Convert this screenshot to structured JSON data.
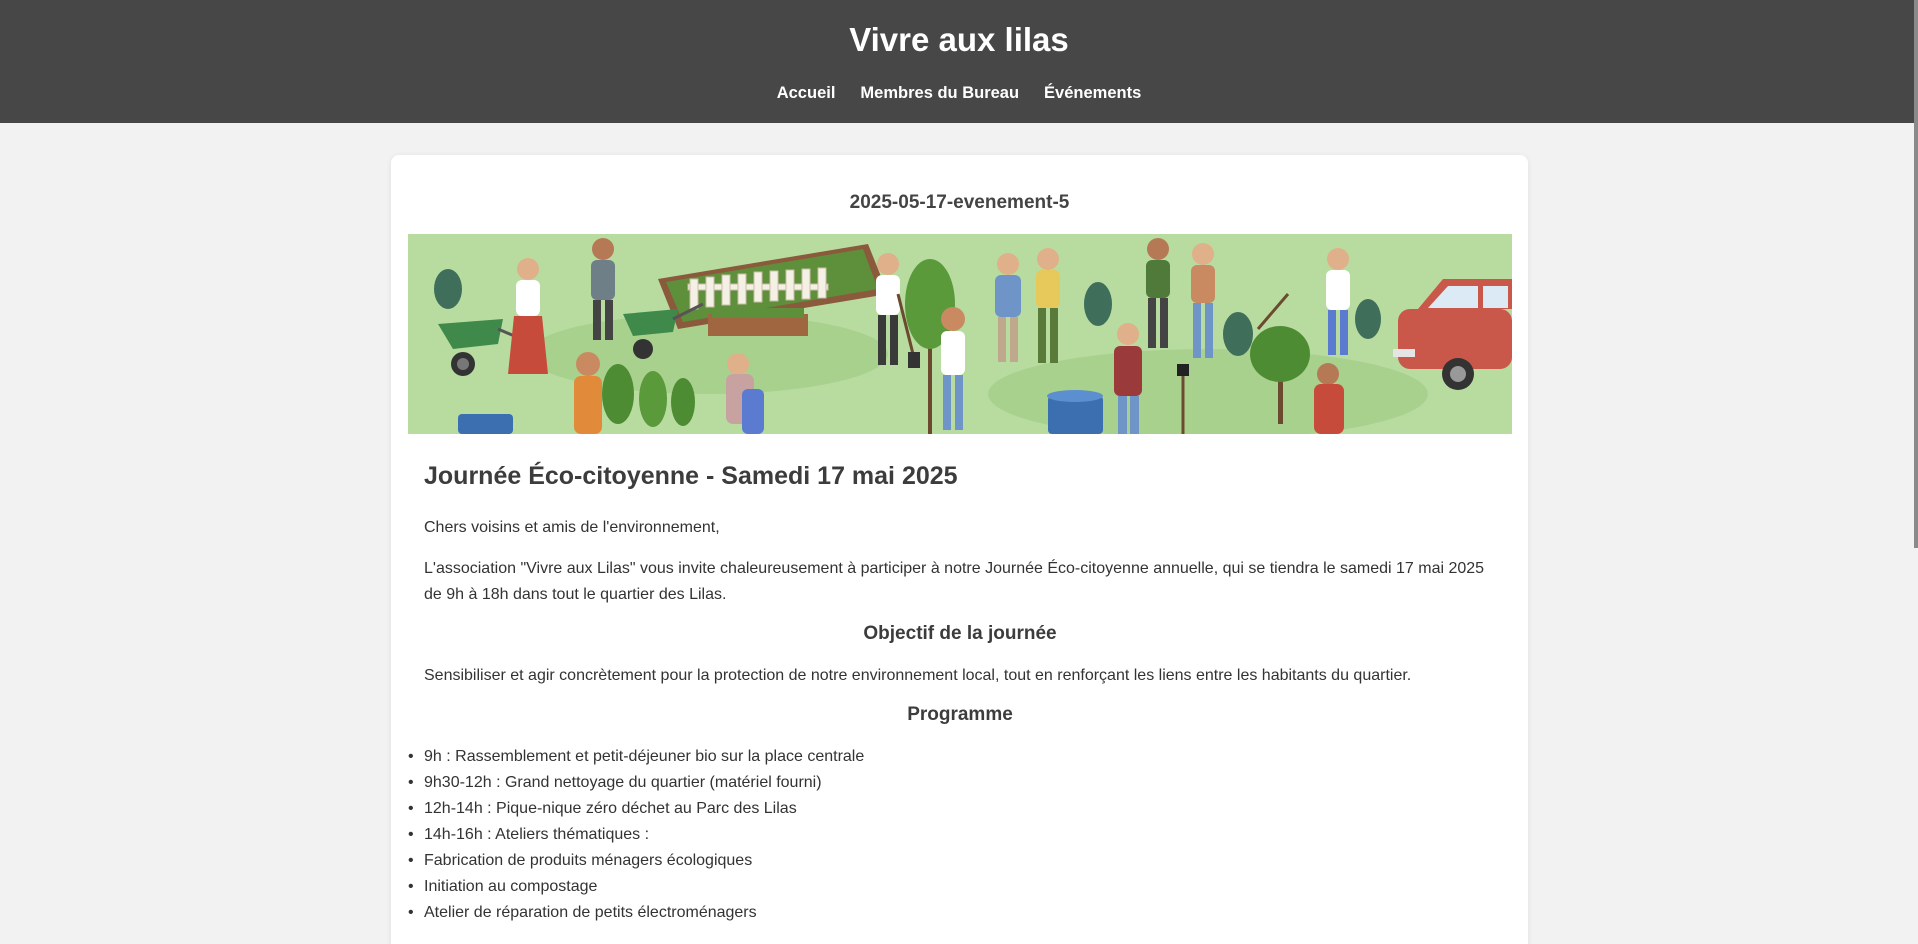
{
  "site": {
    "title": "Vivre aux lilas"
  },
  "nav": [
    {
      "label": "Accueil"
    },
    {
      "label": "Membres du Bureau"
    },
    {
      "label": "Événements"
    }
  ],
  "event": {
    "id": "2025-05-17-evenement-5",
    "title": "Journée Éco-citoyenne - Samedi 17 mai 2025",
    "greeting": "Chers voisins et amis de l'environnement,",
    "intro": "L'association \"Vivre aux Lilas\" vous invite chaleureusement à participer à notre Journée Éco-citoyenne annuelle, qui se tiendra le samedi 17 mai 2025 de 9h à 18h dans tout le quartier des Lilas.",
    "objective_heading": "Objectif de la journée",
    "objective_text": "Sensibiliser et agir concrètement pour la protection de notre environnement local, tout en renforçant les liens entre les habitants du quartier.",
    "program_heading": "Programme",
    "program": [
      "9h : Rassemblement et petit-déjeuner bio sur la place centrale",
      "9h30-12h : Grand nettoyage du quartier (matériel fourni)",
      "12h-14h : Pique-nique zéro déchet au Parc des Lilas",
      "14h-16h : Ateliers thématiques :",
      "Fabrication de produits ménagers écologiques",
      "Initiation au compostage",
      "Atelier de réparation de petits électroménagers"
    ]
  },
  "colors": {
    "header_bg": "#474747",
    "page_bg": "#f2f2f2",
    "card_bg": "#ffffff",
    "banner_grass": "#b8dca0"
  }
}
